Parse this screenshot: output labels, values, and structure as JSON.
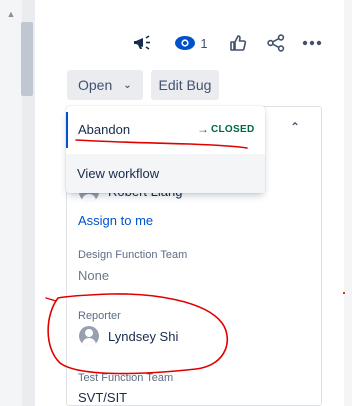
{
  "actions": {
    "feedback_icon": "megaphone-icon",
    "watch_icon": "eye-icon",
    "watch_count": "1",
    "vote_icon": "thumbs-up-icon",
    "share_icon": "share-icon",
    "more_icon": "ellipsis-icon"
  },
  "status_button": {
    "label": "Open",
    "icon": "chevron-down-icon"
  },
  "edit_button": {
    "label": "Edit Bug"
  },
  "transition_menu": {
    "items": [
      {
        "label": "Abandon",
        "arrow": "→",
        "target_status": "CLOSED"
      },
      {
        "label": "View workflow"
      }
    ]
  },
  "details": {
    "assignee": {
      "name": "Robert Liang",
      "assign_to_me": "Assign to me"
    },
    "design_function_team": {
      "label": "Design Function Team",
      "value": "None"
    },
    "reporter": {
      "label": "Reporter",
      "name": "Lyndsey Shi"
    },
    "test_function_team": {
      "label": "Test Function Team",
      "value": "SVT/SIT"
    }
  },
  "colors": {
    "accent": "#0052cc",
    "closed_status": "#006644",
    "annotation": "#e00000"
  }
}
